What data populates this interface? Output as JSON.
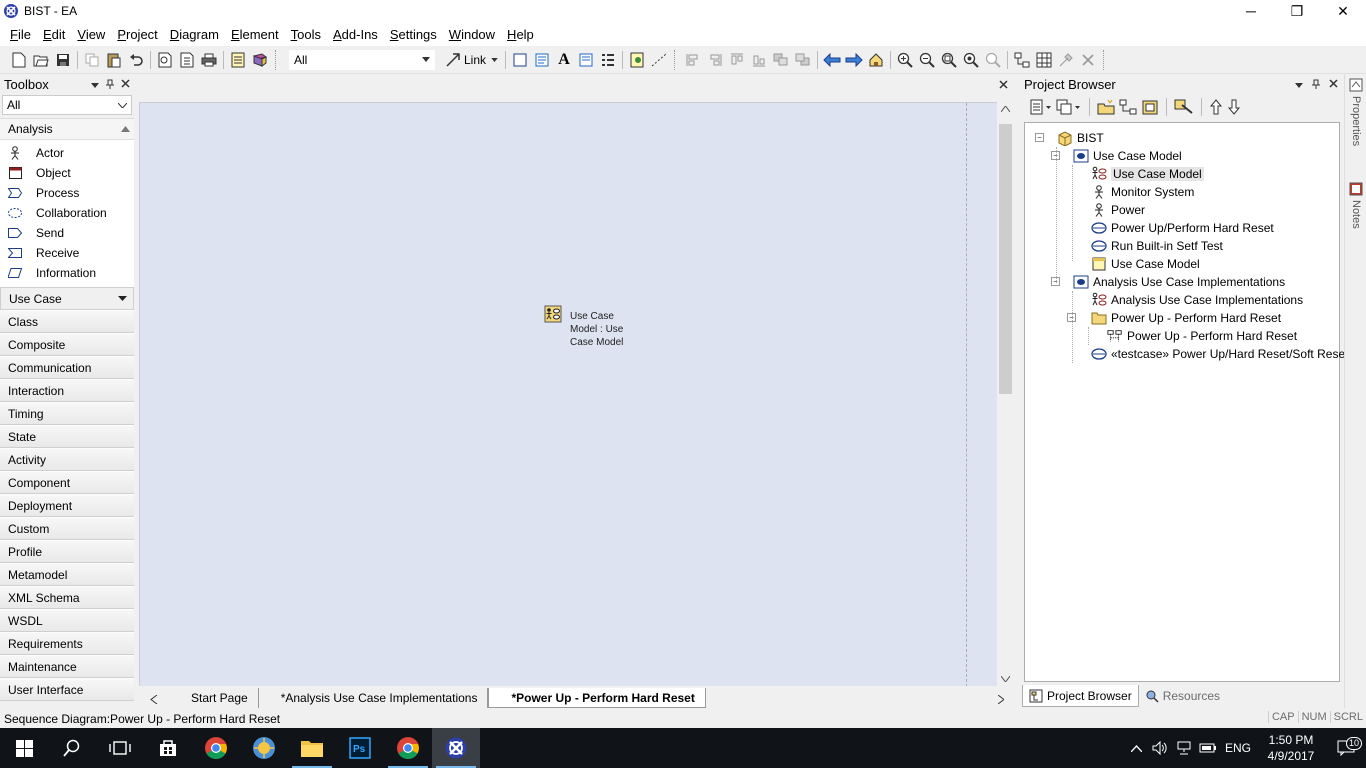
{
  "window": {
    "title": "BIST - EA",
    "minimize_glyph": "─",
    "restore_glyph": "❐",
    "close_glyph": "✕"
  },
  "menubar": {
    "items": [
      {
        "u": "F",
        "rest": "ile"
      },
      {
        "u": "E",
        "rest": "dit"
      },
      {
        "u": "V",
        "rest": "iew"
      },
      {
        "u": "P",
        "rest": "roject"
      },
      {
        "u": "D",
        "rest": "iagram"
      },
      {
        "u": "E",
        "rest": "lement"
      },
      {
        "u": "T",
        "rest": "ools"
      },
      {
        "u": "A",
        "rest": "dd-Ins"
      },
      {
        "u": "S",
        "rest": "ettings"
      },
      {
        "u": "W",
        "rest": "indow"
      },
      {
        "u": "H",
        "rest": "elp"
      }
    ]
  },
  "toolbar": {
    "scope_value": "All",
    "link_label": "Link"
  },
  "toolbox": {
    "title": "Toolbox",
    "filter_value": "All",
    "open_group": "Analysis",
    "items": [
      {
        "label": "Actor",
        "icon": "actor-icon"
      },
      {
        "label": "Object",
        "icon": "object-icon"
      },
      {
        "label": "Process",
        "icon": "process-icon"
      },
      {
        "label": "Collaboration",
        "icon": "collaboration-icon"
      },
      {
        "label": "Send",
        "icon": "send-icon"
      },
      {
        "label": "Receive",
        "icon": "receive-icon"
      },
      {
        "label": "Information",
        "icon": "information-icon"
      }
    ],
    "selected_group": "Use Case",
    "groups": [
      "Class",
      "Composite",
      "Communication",
      "Interaction",
      "Timing",
      "State",
      "Activity",
      "Component",
      "Deployment",
      "Custom",
      "Profile",
      "Metamodel",
      "XML Schema",
      "WSDL",
      "Requirements",
      "Maintenance",
      "User Interface"
    ]
  },
  "diagram": {
    "element_label": "Use Case Model : Use Case Model",
    "tabs": [
      "Start Page",
      "*Analysis Use Case Implementations",
      "*Power Up - Perform Hard Reset"
    ],
    "active_tab_index": 2
  },
  "project_browser": {
    "title": "Project Browser",
    "tree": [
      {
        "label": "BIST",
        "icon": "model-root-icon"
      },
      {
        "label": "Use Case Model",
        "icon": "view-icon"
      },
      {
        "label": "Use Case Model",
        "icon": "usecase-diagram-icon",
        "selected": true
      },
      {
        "label": "Monitor System",
        "icon": "actor-icon"
      },
      {
        "label": "Power",
        "icon": "actor-icon"
      },
      {
        "label": "Power Up/Perform Hard Reset",
        "icon": "usecase-icon"
      },
      {
        "label": "Run Built-in Setf Test",
        "icon": "usecase-icon"
      },
      {
        "label": "Use Case Model",
        "icon": "package-note-icon"
      },
      {
        "label": "Analysis Use Case Implementations",
        "icon": "view-icon"
      },
      {
        "label": "Analysis Use Case Implementations",
        "icon": "usecase-diagram-icon"
      },
      {
        "label": "Power Up - Perform Hard Reset",
        "icon": "folder-icon"
      },
      {
        "label": "Power Up - Perform Hard Reset",
        "icon": "sequence-diagram-icon"
      },
      {
        "label": "«testcase» Power Up/Hard Reset/Soft Reset",
        "icon": "usecase-icon"
      }
    ],
    "tabs": [
      "Project Browser",
      "Resources"
    ]
  },
  "side_tabs": [
    "Properties",
    "Notes"
  ],
  "status": {
    "text": "Sequence Diagram:Power Up - Perform Hard Reset",
    "indicators": [
      "CAP",
      "NUM",
      "SCRL"
    ]
  },
  "taskbar": {
    "language": "ENG",
    "time": "1:50 PM",
    "date": "4/9/2017",
    "notification_count": "10"
  }
}
